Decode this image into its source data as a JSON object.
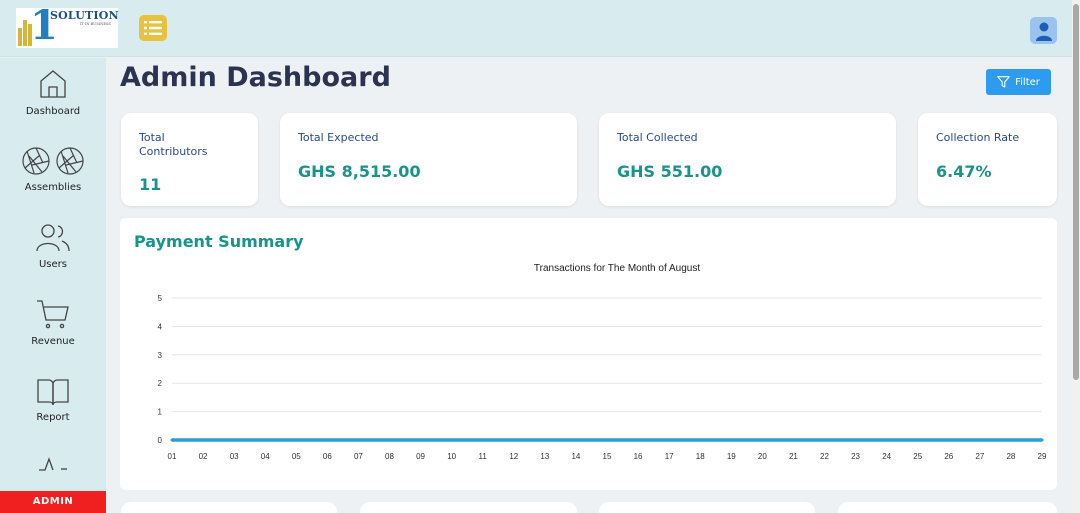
{
  "brand": {
    "name": "SOLUTION",
    "tagline": "IT IN BUSINESS",
    "digit": "1"
  },
  "header": {
    "menu_icon": "list-icon",
    "user_icon": "user-icon"
  },
  "sidebar": {
    "items": [
      {
        "label": "Dashboard",
        "icon": "home-icon"
      },
      {
        "label": "Assemblies",
        "icon": "aperture-icon"
      },
      {
        "label": "Users",
        "icon": "users-icon"
      },
      {
        "label": "Revenue",
        "icon": "cart-icon"
      },
      {
        "label": "Report",
        "icon": "book-icon"
      },
      {
        "label": "",
        "icon": "activity-icon"
      }
    ],
    "role": "ADMIN"
  },
  "page": {
    "title": "Admin Dashboard",
    "filter_label": "Filter"
  },
  "cards": [
    {
      "title": "Total Contributors",
      "value": "11"
    },
    {
      "title": "Total Expected",
      "value": "GHS 8,515.00"
    },
    {
      "title": "Total Collected",
      "value": "GHS 551.00"
    },
    {
      "title": "Collection Rate",
      "value": "6.47%"
    }
  ],
  "summary": {
    "title": "Payment Summary"
  },
  "colors": {
    "accent": "#16958a",
    "line": "#2d9cdb",
    "admin": "#f02020",
    "menu": "#e8c140"
  },
  "chart_data": {
    "type": "line",
    "title": "Transactions for The Month of August",
    "xlabel": "",
    "ylabel": "",
    "categories": [
      "01",
      "02",
      "03",
      "04",
      "05",
      "06",
      "07",
      "08",
      "09",
      "10",
      "11",
      "12",
      "13",
      "14",
      "15",
      "16",
      "17",
      "18",
      "19",
      "20",
      "21",
      "22",
      "23",
      "24",
      "25",
      "26",
      "27",
      "28",
      "29"
    ],
    "ylim": [
      0,
      5
    ],
    "yticks": [
      "0",
      "1",
      "2",
      "3",
      "4",
      "5"
    ],
    "grid": true,
    "series": [
      {
        "values": [
          0,
          0,
          0,
          0,
          0,
          0,
          0,
          0,
          0,
          0,
          0,
          0,
          0,
          0,
          0,
          0,
          0,
          0,
          0,
          0,
          0,
          0,
          0,
          0,
          0,
          0,
          0,
          0,
          0
        ]
      }
    ]
  }
}
